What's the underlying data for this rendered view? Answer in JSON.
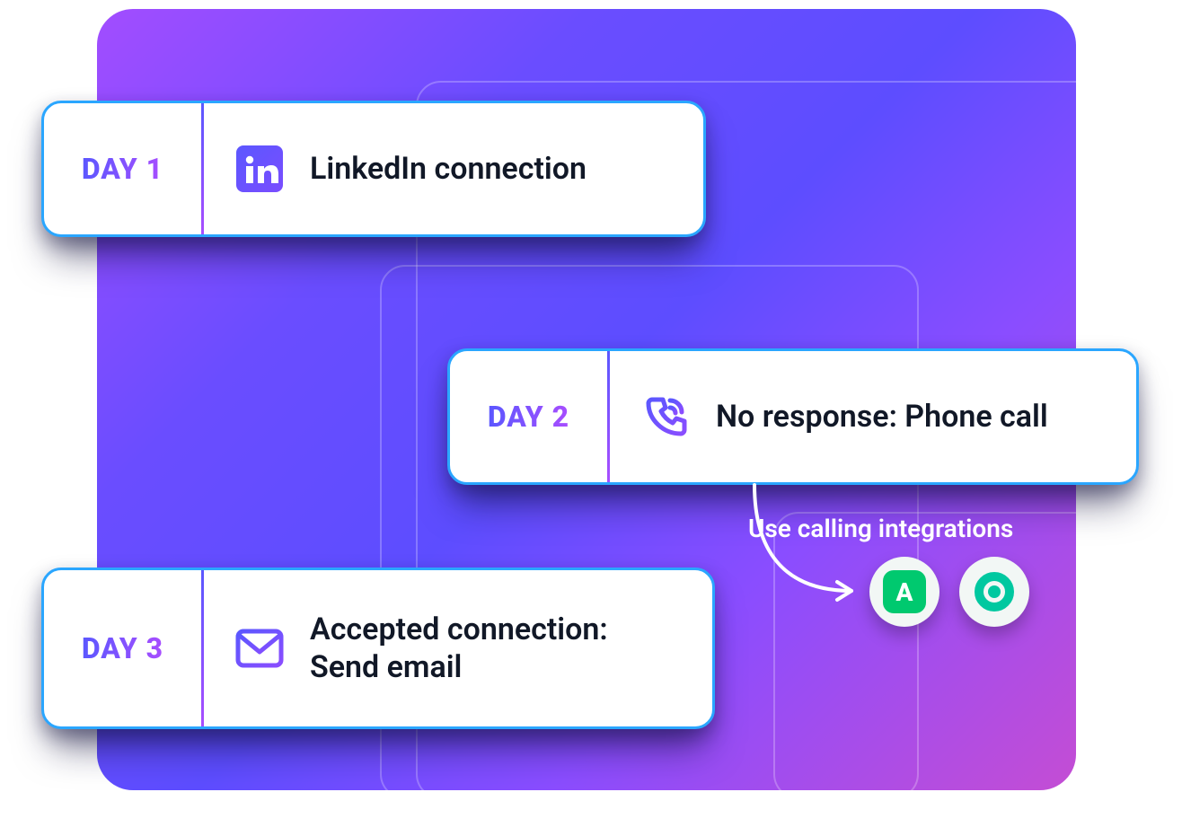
{
  "steps": [
    {
      "day_label": "DAY 1",
      "text": "LinkedIn connection",
      "icon": "linkedin"
    },
    {
      "day_label": "DAY 2",
      "text": "No response: Phone call",
      "icon": "phone"
    },
    {
      "day_label": "DAY 3",
      "text": "Accepted connection: Send email",
      "icon": "email"
    }
  ],
  "annotation": {
    "text": "Use calling integrations",
    "integrations": [
      {
        "name": "aircall",
        "letter": "A"
      },
      {
        "name": "cloudtalk"
      }
    ]
  }
}
